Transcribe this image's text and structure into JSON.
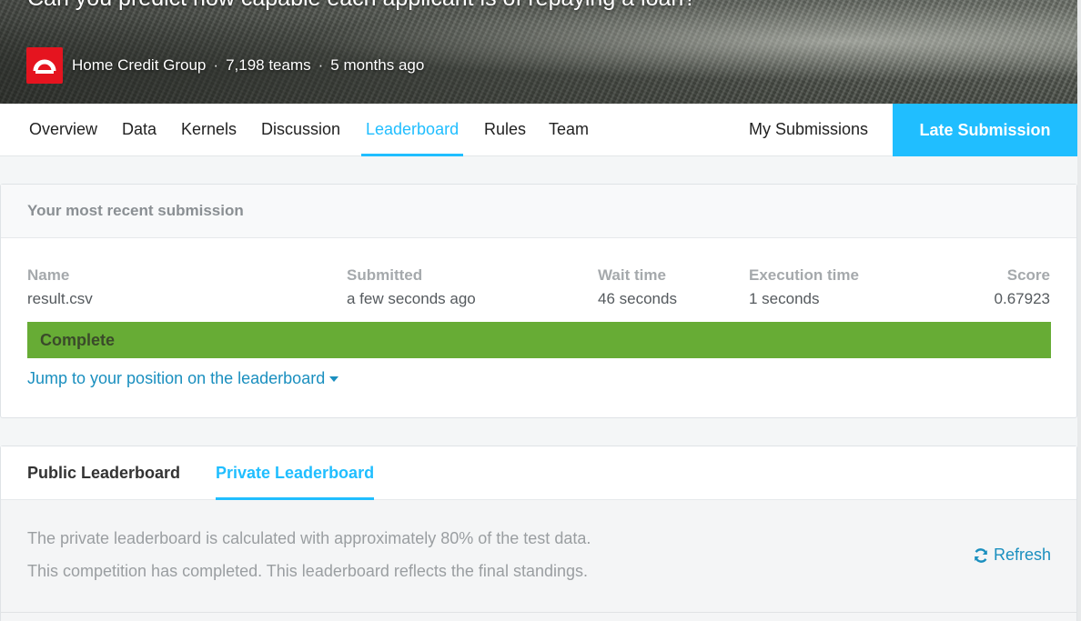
{
  "hero": {
    "title": "Can you predict how capable each applicant is of repaying a loan?",
    "host": "Home Credit Group",
    "teams": "7,198 teams",
    "age": "5 months ago",
    "separator": "·"
  },
  "nav": {
    "tabs": [
      "Overview",
      "Data",
      "Kernels",
      "Discussion",
      "Leaderboard",
      "Rules",
      "Team"
    ],
    "active_tab": "Leaderboard",
    "my_submissions": "My Submissions",
    "late_submission": "Late Submission",
    "accent_color": "#20beff"
  },
  "submission": {
    "header": "Your most recent submission",
    "columns": {
      "name": {
        "label": "Name",
        "value": "result.csv"
      },
      "submitted": {
        "label": "Submitted",
        "value": "a few seconds ago"
      },
      "wait": {
        "label": "Wait time",
        "value": "46 seconds"
      },
      "execution": {
        "label": "Execution time",
        "value": "1 seconds"
      },
      "score": {
        "label": "Score",
        "value": "0.67923"
      }
    },
    "status": "Complete",
    "status_color": "#67ac35",
    "jump_link": "Jump to your position on the leaderboard"
  },
  "leaderboard": {
    "tabs": {
      "public": "Public Leaderboard",
      "private": "Private Leaderboard"
    },
    "active": "Private Leaderboard",
    "note_1": "The private leaderboard is calculated with approximately 80% of the test data.",
    "note_2": "This competition has completed. This leaderboard reflects the final standings.",
    "refresh": "Refresh"
  },
  "icons": {
    "host_logo": "home-credit-logo",
    "jump_caret": "caret-down-icon",
    "refresh": "refresh-icon"
  }
}
